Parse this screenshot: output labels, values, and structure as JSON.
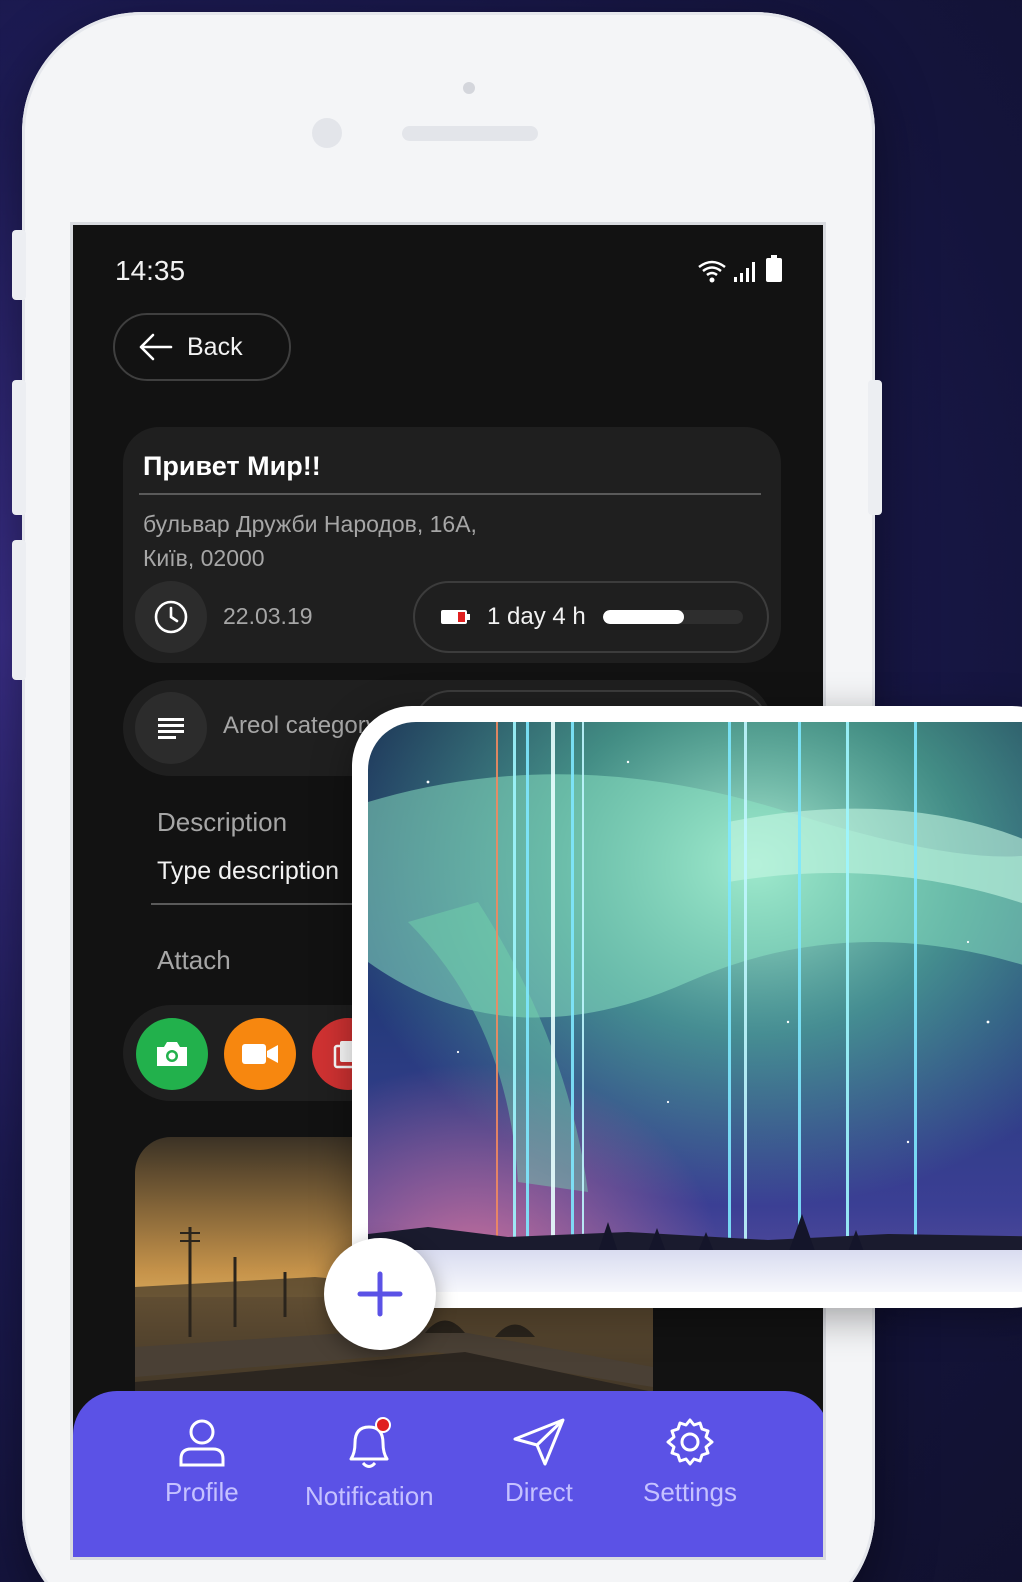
{
  "status_bar": {
    "time": "14:35"
  },
  "back_button": {
    "label": "Back"
  },
  "card": {
    "title": "Привет Мир!!",
    "address_line1": "бульвар Дружби Народов, 16А,",
    "address_line2": "Київ, 02000",
    "date": "22.03.19",
    "timer_label": "1 day 4 h",
    "timer_progress_fraction": 0.58
  },
  "category": {
    "label": "Areol category"
  },
  "description": {
    "label": "Description",
    "value": "Type description"
  },
  "attach": {
    "label": "Attach",
    "buttons": [
      {
        "icon": "camera-icon",
        "color": "#22b14c"
      },
      {
        "icon": "video-camera-icon",
        "color": "#f7870f"
      },
      {
        "icon": "gallery-icon",
        "color": "#d13232"
      }
    ]
  },
  "tab_bar": {
    "background": "#5b52e6",
    "items": [
      {
        "label": "Profile",
        "icon": "user-icon"
      },
      {
        "label": "Notification",
        "icon": "bell-icon",
        "badge": true
      },
      {
        "label": "Direct",
        "icon": "send-icon"
      },
      {
        "label": "Settings",
        "icon": "gear-icon"
      }
    ]
  },
  "colors": {
    "accent": "#5b52e6",
    "badge": "#e02020",
    "screen_bg": "#121212",
    "card_bg": "#1f1f1f"
  }
}
